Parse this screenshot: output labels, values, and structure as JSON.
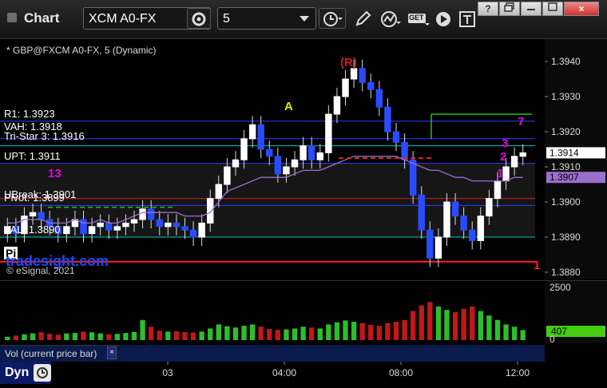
{
  "toolbar": {
    "app_title": "Chart",
    "symbol_value": "XCM A0-FX",
    "interval_value": "5",
    "get_label": "GET",
    "window_controls": [
      "?",
      "",
      "",
      "×"
    ]
  },
  "chart": {
    "symbol_line": "* GBP@FXCM A0-FX, 5 (Dynamic)",
    "watermark": "tradesight.com",
    "copyright": "© eSignal, 2021",
    "levels": [
      {
        "label": "R1: 1.3923",
        "price": 1.3923,
        "color": "#2f3fff"
      },
      {
        "label": "VAH: 1.3918",
        "price": 1.3918,
        "color": "#2f3fff"
      },
      {
        "label": "Tri-Star 3: 1.3916",
        "price": 1.3916,
        "color": "#00c8c8"
      },
      {
        "label": "UPT: 1.3911",
        "price": 1.3911,
        "color": "#2f3fff"
      },
      {
        "label": "UBreak: 1.3901",
        "price": 1.3901,
        "color": "#cc2222"
      },
      {
        "label": "Pivot: 1.3899",
        "price": 1.3899,
        "color": "#2f3fff"
      },
      {
        "label": "VAL: 1.3890",
        "price": 1.389,
        "color": "#00c8c8"
      },
      {
        "label": "Pi",
        "price": 1.3883,
        "color": "#ff2222"
      }
    ],
    "annotations": [
      {
        "text": "(R)",
        "color": "#c81e1e"
      },
      {
        "text": "A",
        "color": "#e6e600"
      },
      {
        "text": "13",
        "color": "#e600e6"
      },
      {
        "text": "1",
        "color": "#ff2020"
      },
      {
        "text": "7",
        "color": "#e600e6"
      },
      {
        "text": "3",
        "color": "#e600e6"
      },
      {
        "text": "2",
        "color": "#e600e6"
      },
      {
        "text": "1",
        "color": "#e600e6"
      }
    ],
    "price_axis": [
      "1.3940",
      "1.3930",
      "1.3920",
      "1.3910",
      "1.3900",
      "1.3890",
      "1.3880"
    ],
    "price_tags": [
      {
        "text": "1.3914",
        "bg": "#ffffff",
        "fg": "#000000"
      },
      {
        "text": "1.3907",
        "bg": "#9a6fd0",
        "fg": "#000000"
      }
    ],
    "time_axis": [
      "03",
      "04:00",
      "08:00",
      "12:00"
    ],
    "dynamic_label": "Dyn"
  },
  "volume": {
    "label": "Vol (current price bar)",
    "axis": [
      "2500",
      "0"
    ],
    "current": "407"
  },
  "chart_data": {
    "type": "candlestick",
    "title": "GBP@FXCM A0-FX, 5 (Dynamic)",
    "ylim": [
      1.388,
      1.3945
    ],
    "x_ticks": [
      "03",
      "04:00",
      "08:00",
      "12:00"
    ],
    "price_path": [
      1.3893,
      1.3891,
      1.3896,
      1.3897,
      1.3895,
      1.3893,
      1.3891,
      1.3893,
      1.3895,
      1.3891,
      1.3893,
      1.3894,
      1.3892,
      1.3893,
      1.3894,
      1.3895,
      1.3898,
      1.3895,
      1.3893,
      1.3894,
      1.3893,
      1.3892,
      1.389,
      1.3894,
      1.3901,
      1.3905,
      1.391,
      1.3912,
      1.3918,
      1.3922,
      1.3915,
      1.3913,
      1.3908,
      1.391,
      1.3912,
      1.3916,
      1.3912,
      1.3914,
      1.3925,
      1.393,
      1.3935,
      1.3938,
      1.3934,
      1.3932,
      1.3927,
      1.392,
      1.3917,
      1.3912,
      1.3902,
      1.3892,
      1.3884,
      1.389,
      1.39,
      1.3896,
      1.3892,
      1.3889,
      1.3896,
      1.3901,
      1.3906,
      1.391,
      1.3913,
      1.3914
    ],
    "vwap_path": [
      1.3894,
      1.3894,
      1.3895,
      1.3895,
      1.3895,
      1.3894,
      1.3894,
      1.3894,
      1.3895,
      1.3894,
      1.3894,
      1.3895,
      1.3894,
      1.3894,
      1.3895,
      1.3896,
      1.3897,
      1.3897,
      1.3897,
      1.3897,
      1.3897,
      1.3896,
      1.3896,
      1.3896,
      1.3897,
      1.39,
      1.3903,
      1.3904,
      1.3905,
      1.3906,
      1.3907,
      1.3907,
      1.3907,
      1.3907,
      1.3908,
      1.3909,
      1.3909,
      1.3909,
      1.391,
      1.3911,
      1.3912,
      1.3913,
      1.3913,
      1.3913,
      1.3913,
      1.3913,
      1.3913,
      1.3912,
      1.3911,
      1.391,
      1.3909,
      1.3909,
      1.3908,
      1.3907,
      1.3907,
      1.3906,
      1.3906,
      1.3906,
      1.3906,
      1.3906,
      1.3907,
      1.3907
    ],
    "volume": [
      150,
      200,
      260,
      300,
      350,
      280,
      240,
      300,
      320,
      380,
      350,
      300,
      260,
      280,
      320,
      360,
      900,
      600,
      420,
      380,
      400,
      360,
      340,
      380,
      520,
      700,
      620,
      560,
      640,
      700,
      600,
      500,
      460,
      480,
      520,
      600,
      560,
      520,
      700,
      800,
      880,
      820,
      760,
      680,
      640,
      760,
      820,
      900,
      1300,
      1550,
      1700,
      1500,
      1350,
      1250,
      1400,
      1500,
      1300,
      1100,
      900,
      700,
      600,
      450
    ],
    "volume_ylim": [
      0,
      2500
    ]
  }
}
